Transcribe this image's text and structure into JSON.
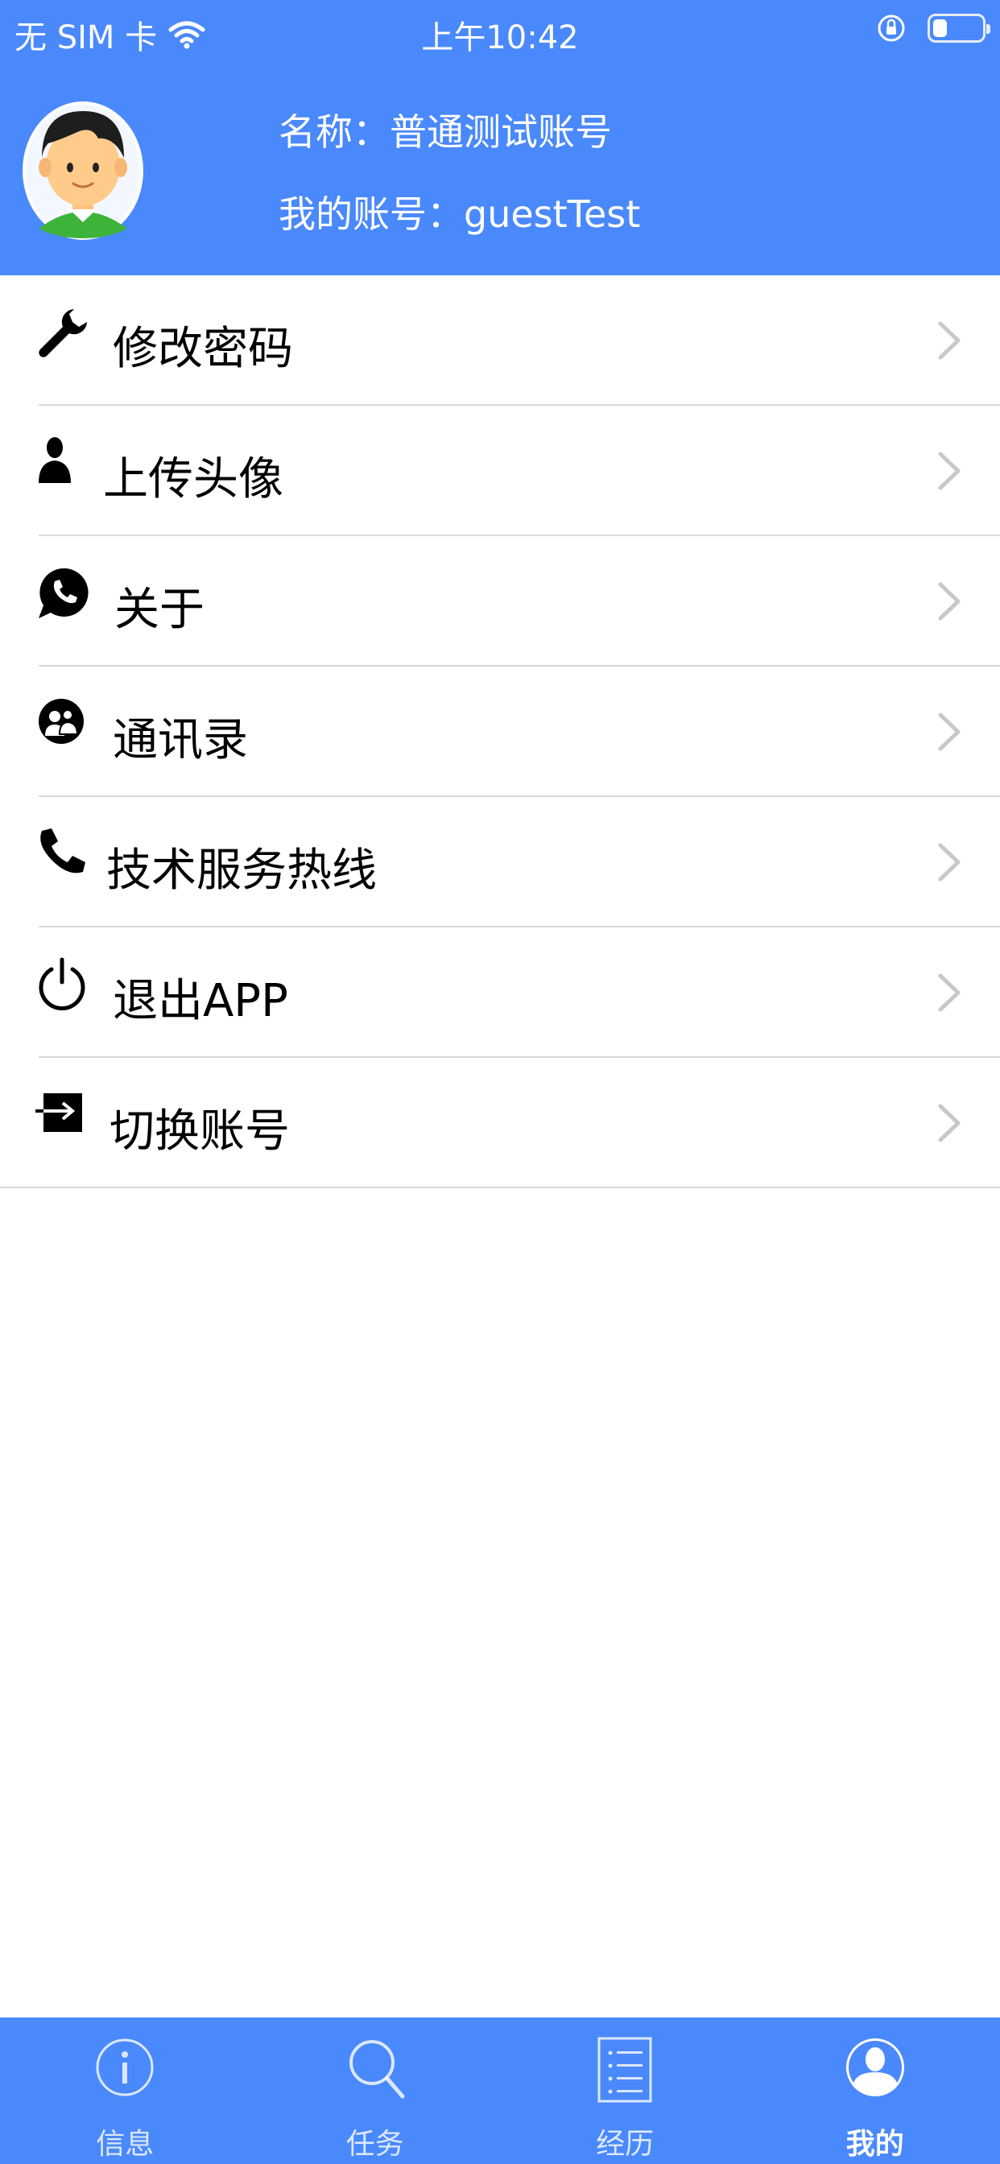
{
  "status_bar": {
    "carrier": "无 SIM 卡",
    "time": "上午10:42",
    "battery_level": 0.3
  },
  "profile": {
    "name_line": "名称：普通测试账号",
    "account_line": "我的账号：guestTest"
  },
  "menu": {
    "items": [
      {
        "label": "修改密码",
        "icon": "wrench-icon"
      },
      {
        "label": "上传头像",
        "icon": "person-icon"
      },
      {
        "label": "关于",
        "icon": "phone-bubble-icon"
      },
      {
        "label": "通讯录",
        "icon": "contacts-icon"
      },
      {
        "label": "技术服务热线",
        "icon": "phone-icon"
      },
      {
        "label": "退出APP",
        "icon": "power-icon"
      },
      {
        "label": "切换账号",
        "icon": "switch-account-icon"
      }
    ]
  },
  "tabbar": {
    "tabs": [
      {
        "label": "信息",
        "icon": "info-icon"
      },
      {
        "label": "任务",
        "icon": "search-icon"
      },
      {
        "label": "经历",
        "icon": "list-icon"
      },
      {
        "label": "我的",
        "icon": "user-icon",
        "active": true
      }
    ]
  },
  "colors": {
    "primary": "#4a89fb",
    "divider": "#d9d9d9",
    "chevron": "#c7c7cc"
  }
}
